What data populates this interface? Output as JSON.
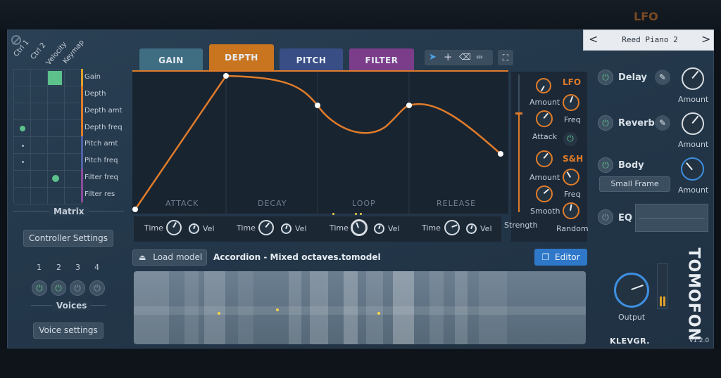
{
  "preset": {
    "name": "Reed Piano 2",
    "prev": "<",
    "next": ">"
  },
  "matrix": {
    "title": "Matrix",
    "columns": [
      "Ctrl 1",
      "Ctrl 2",
      "Velocity",
      "Keymap"
    ],
    "rows": [
      "Gain",
      "Depth",
      "Depth amt",
      "Depth freq",
      "Pitch amt",
      "Pitch freq",
      "Filter freq",
      "Filter res"
    ]
  },
  "controller_settings": "Controller Settings",
  "voices": {
    "numbers": [
      "1",
      "2",
      "3",
      "4"
    ],
    "label": "Voices",
    "settings": "Voice settings"
  },
  "tabs": [
    "GAIN",
    "DEPTH",
    "PITCH",
    "FILTER"
  ],
  "envelope": {
    "segments": [
      "ATTACK",
      "DECAY",
      "LOOP",
      "RELEASE"
    ],
    "time_label": "Time",
    "vel_label": "Vel"
  },
  "mod": {
    "lfo_title": "LFO",
    "sh_title": "S&H",
    "amount": "Amount",
    "freq": "Freq",
    "attack": "Attack",
    "smooth": "Smooth",
    "strength": "Strength",
    "random": "Random"
  },
  "effects": {
    "delay": "Delay",
    "reverb": "Reverb",
    "body": "Body",
    "body_preset": "Small Frame",
    "eq": "EQ",
    "amount": "Amount"
  },
  "model": {
    "load": "Load model",
    "name": "Accordion - Mixed octaves.tomodel",
    "editor": "Editor"
  },
  "output": "Output",
  "brand": "KLEVGR.",
  "product": "TOMOFON",
  "version": "v1.2.0",
  "background": {
    "lfo_ghost": "LFO"
  },
  "colors": {
    "accent": "#e07c2a",
    "power_on": "#63c08a",
    "gain_tab": "#3f6e82",
    "depth_tab": "#c9741f",
    "pitch_tab": "#3a4e86",
    "filter_tab": "#7b3d8a"
  }
}
